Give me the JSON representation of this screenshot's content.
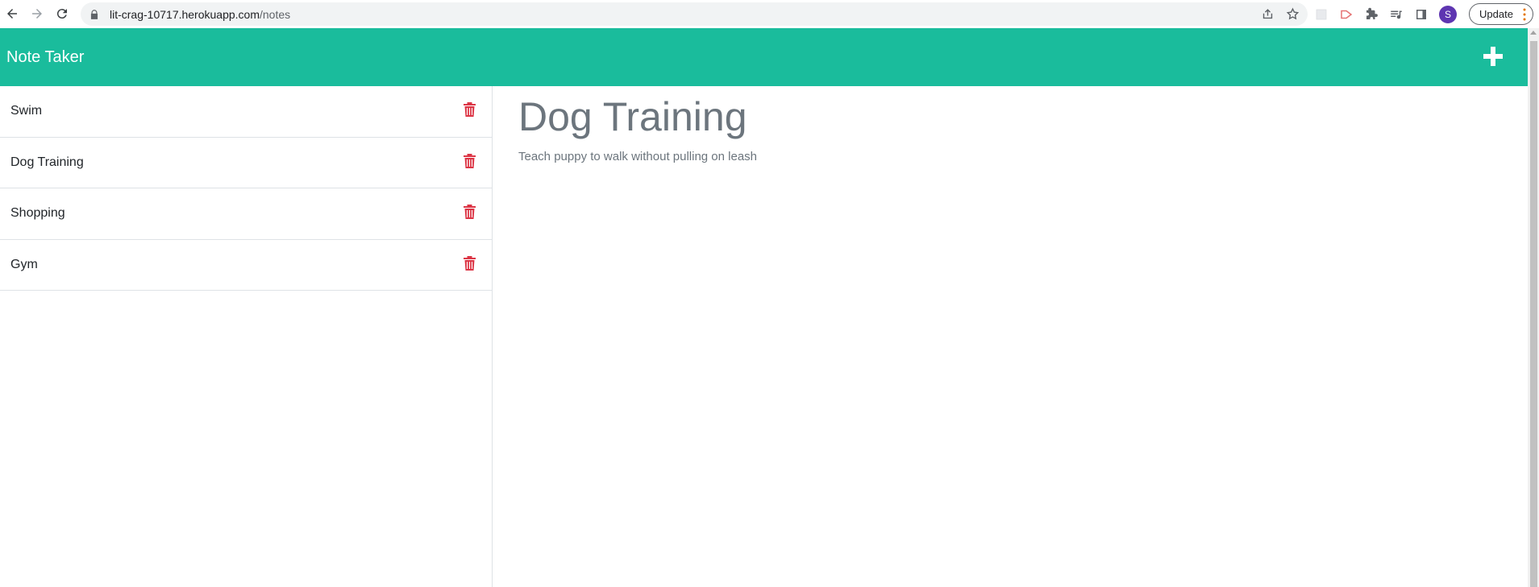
{
  "browser": {
    "url_host": "lit-crag-10717.herokuapp.com",
    "url_path": "/notes",
    "avatar_letter": "S",
    "update_label": "Update"
  },
  "app": {
    "brand": "Note Taker",
    "accent_color": "#1abc9c",
    "delete_color": "#dc3545",
    "add_icon": "plus-icon"
  },
  "notes": [
    {
      "title": "Swim"
    },
    {
      "title": "Dog Training"
    },
    {
      "title": "Shopping"
    },
    {
      "title": "Gym"
    }
  ],
  "active_note": {
    "title": "Dog Training",
    "text": "Teach puppy to walk without pulling on leash"
  }
}
